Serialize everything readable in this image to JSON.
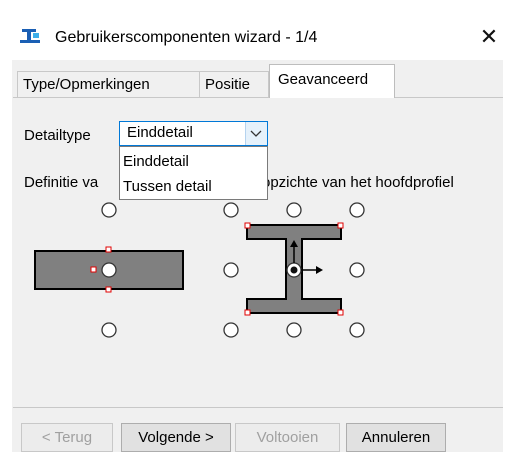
{
  "window": {
    "title": "Gebruikerscomponenten wizard - 1/4",
    "close_icon": "close-icon",
    "app_icon": "component-wizard-icon"
  },
  "tabs": [
    {
      "label": "Type/Opmerkingen",
      "active": false
    },
    {
      "label": "Positie",
      "active": false
    },
    {
      "label": "Geavanceerd",
      "active": true
    }
  ],
  "detail": {
    "label": "Detailtype",
    "selected": "Einddetail",
    "options": [
      "Einddetail",
      "Tussen detail"
    ],
    "dropdown_icon": "chevron-down-icon"
  },
  "definition": {
    "label_left": "Definitie va",
    "label_right": "opzichte van het hoofdprofiel"
  },
  "colors": {
    "accent": "#0078d7",
    "profile_fill": "#808080",
    "handle": "#e00000"
  },
  "buttons": {
    "back": "< Terug",
    "next": "Volgende >",
    "finish": "Voltooien",
    "cancel": "Annuleren"
  }
}
